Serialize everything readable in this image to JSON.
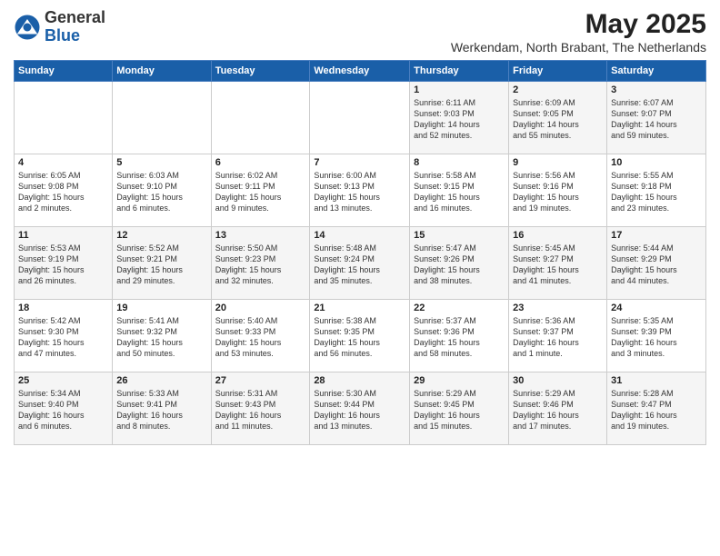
{
  "logo": {
    "general": "General",
    "blue": "Blue"
  },
  "title": "May 2025",
  "subtitle": "Werkendam, North Brabant, The Netherlands",
  "days_of_week": [
    "Sunday",
    "Monday",
    "Tuesday",
    "Wednesday",
    "Thursday",
    "Friday",
    "Saturday"
  ],
  "weeks": [
    [
      {
        "day": "",
        "info": ""
      },
      {
        "day": "",
        "info": ""
      },
      {
        "day": "",
        "info": ""
      },
      {
        "day": "",
        "info": ""
      },
      {
        "day": "1",
        "info": "Sunrise: 6:11 AM\nSunset: 9:03 PM\nDaylight: 14 hours\nand 52 minutes."
      },
      {
        "day": "2",
        "info": "Sunrise: 6:09 AM\nSunset: 9:05 PM\nDaylight: 14 hours\nand 55 minutes."
      },
      {
        "day": "3",
        "info": "Sunrise: 6:07 AM\nSunset: 9:07 PM\nDaylight: 14 hours\nand 59 minutes."
      }
    ],
    [
      {
        "day": "4",
        "info": "Sunrise: 6:05 AM\nSunset: 9:08 PM\nDaylight: 15 hours\nand 2 minutes."
      },
      {
        "day": "5",
        "info": "Sunrise: 6:03 AM\nSunset: 9:10 PM\nDaylight: 15 hours\nand 6 minutes."
      },
      {
        "day": "6",
        "info": "Sunrise: 6:02 AM\nSunset: 9:11 PM\nDaylight: 15 hours\nand 9 minutes."
      },
      {
        "day": "7",
        "info": "Sunrise: 6:00 AM\nSunset: 9:13 PM\nDaylight: 15 hours\nand 13 minutes."
      },
      {
        "day": "8",
        "info": "Sunrise: 5:58 AM\nSunset: 9:15 PM\nDaylight: 15 hours\nand 16 minutes."
      },
      {
        "day": "9",
        "info": "Sunrise: 5:56 AM\nSunset: 9:16 PM\nDaylight: 15 hours\nand 19 minutes."
      },
      {
        "day": "10",
        "info": "Sunrise: 5:55 AM\nSunset: 9:18 PM\nDaylight: 15 hours\nand 23 minutes."
      }
    ],
    [
      {
        "day": "11",
        "info": "Sunrise: 5:53 AM\nSunset: 9:19 PM\nDaylight: 15 hours\nand 26 minutes."
      },
      {
        "day": "12",
        "info": "Sunrise: 5:52 AM\nSunset: 9:21 PM\nDaylight: 15 hours\nand 29 minutes."
      },
      {
        "day": "13",
        "info": "Sunrise: 5:50 AM\nSunset: 9:23 PM\nDaylight: 15 hours\nand 32 minutes."
      },
      {
        "day": "14",
        "info": "Sunrise: 5:48 AM\nSunset: 9:24 PM\nDaylight: 15 hours\nand 35 minutes."
      },
      {
        "day": "15",
        "info": "Sunrise: 5:47 AM\nSunset: 9:26 PM\nDaylight: 15 hours\nand 38 minutes."
      },
      {
        "day": "16",
        "info": "Sunrise: 5:45 AM\nSunset: 9:27 PM\nDaylight: 15 hours\nand 41 minutes."
      },
      {
        "day": "17",
        "info": "Sunrise: 5:44 AM\nSunset: 9:29 PM\nDaylight: 15 hours\nand 44 minutes."
      }
    ],
    [
      {
        "day": "18",
        "info": "Sunrise: 5:42 AM\nSunset: 9:30 PM\nDaylight: 15 hours\nand 47 minutes."
      },
      {
        "day": "19",
        "info": "Sunrise: 5:41 AM\nSunset: 9:32 PM\nDaylight: 15 hours\nand 50 minutes."
      },
      {
        "day": "20",
        "info": "Sunrise: 5:40 AM\nSunset: 9:33 PM\nDaylight: 15 hours\nand 53 minutes."
      },
      {
        "day": "21",
        "info": "Sunrise: 5:38 AM\nSunset: 9:35 PM\nDaylight: 15 hours\nand 56 minutes."
      },
      {
        "day": "22",
        "info": "Sunrise: 5:37 AM\nSunset: 9:36 PM\nDaylight: 15 hours\nand 58 minutes."
      },
      {
        "day": "23",
        "info": "Sunrise: 5:36 AM\nSunset: 9:37 PM\nDaylight: 16 hours\nand 1 minute."
      },
      {
        "day": "24",
        "info": "Sunrise: 5:35 AM\nSunset: 9:39 PM\nDaylight: 16 hours\nand 3 minutes."
      }
    ],
    [
      {
        "day": "25",
        "info": "Sunrise: 5:34 AM\nSunset: 9:40 PM\nDaylight: 16 hours\nand 6 minutes."
      },
      {
        "day": "26",
        "info": "Sunrise: 5:33 AM\nSunset: 9:41 PM\nDaylight: 16 hours\nand 8 minutes."
      },
      {
        "day": "27",
        "info": "Sunrise: 5:31 AM\nSunset: 9:43 PM\nDaylight: 16 hours\nand 11 minutes."
      },
      {
        "day": "28",
        "info": "Sunrise: 5:30 AM\nSunset: 9:44 PM\nDaylight: 16 hours\nand 13 minutes."
      },
      {
        "day": "29",
        "info": "Sunrise: 5:29 AM\nSunset: 9:45 PM\nDaylight: 16 hours\nand 15 minutes."
      },
      {
        "day": "30",
        "info": "Sunrise: 5:29 AM\nSunset: 9:46 PM\nDaylight: 16 hours\nand 17 minutes."
      },
      {
        "day": "31",
        "info": "Sunrise: 5:28 AM\nSunset: 9:47 PM\nDaylight: 16 hours\nand 19 minutes."
      }
    ]
  ]
}
